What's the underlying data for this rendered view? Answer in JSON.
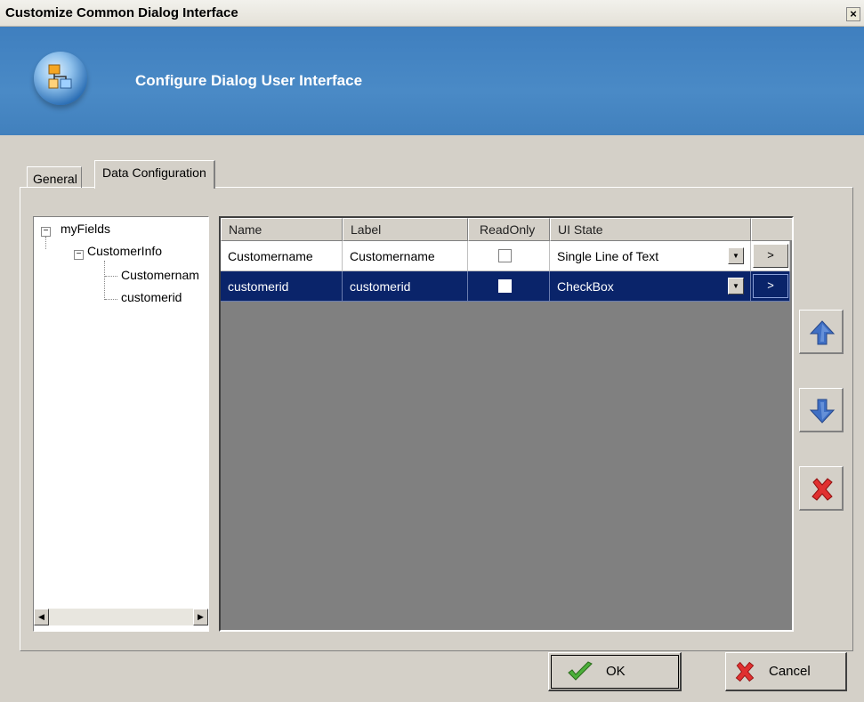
{
  "window": {
    "title": "Customize Common Dialog Interface",
    "close_glyph": "×"
  },
  "header": {
    "title": "Configure Dialog User Interface",
    "icon": "dialog-config-icon"
  },
  "tabs": [
    {
      "label": "General",
      "active": false
    },
    {
      "label": "Data Configuration",
      "active": true
    }
  ],
  "tree": {
    "root": "myFields",
    "group": "CustomerInfo",
    "children": [
      "Customernam",
      "customerid"
    ]
  },
  "grid": {
    "columns": [
      "Name",
      "Label",
      "ReadOnly",
      "UI State"
    ],
    "rows": [
      {
        "name": "Customername",
        "label": "Customername",
        "readonly": false,
        "ui_state": "Single Line of Text",
        "selected": false
      },
      {
        "name": "customerid",
        "label": "customerid",
        "readonly": false,
        "ui_state": "CheckBox",
        "selected": true
      }
    ],
    "more_glyph": ">"
  },
  "side_buttons": {
    "up_icon": "arrow-up-icon",
    "down_icon": "arrow-down-icon",
    "delete_icon": "delete-x-icon"
  },
  "buttons": {
    "ok": "OK",
    "cancel": "Cancel"
  },
  "colors": {
    "header_blue": "#4a8ac6",
    "selection": "#0a246a",
    "dialog_face": "#d4d0c8",
    "arrow_blue": "#3f6fc4",
    "delete_red": "#e03030"
  }
}
